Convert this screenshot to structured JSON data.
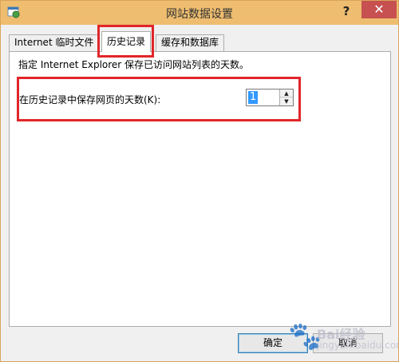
{
  "window": {
    "title": "网站数据设置",
    "help_label": "?",
    "close_label": "✕",
    "icons": {
      "app": "internet-options-icon",
      "help": "help-icon",
      "close": "close-icon"
    }
  },
  "tabs": [
    {
      "label": "Internet 临时文件",
      "active": false
    },
    {
      "label": "历史记录",
      "active": true
    },
    {
      "label": "缓存和数据库",
      "active": false
    }
  ],
  "history": {
    "description": "指定 Internet Explorer 保存已访问网站列表的天数。",
    "days_label": "在历史记录中保存网页的天数(K):",
    "days_value": "1"
  },
  "buttons": {
    "ok": "确定",
    "cancel": "取消"
  },
  "highlight_color": "#e0262a",
  "watermark": {
    "text": "Bai经验",
    "url": "jingyan.baidu.com"
  }
}
